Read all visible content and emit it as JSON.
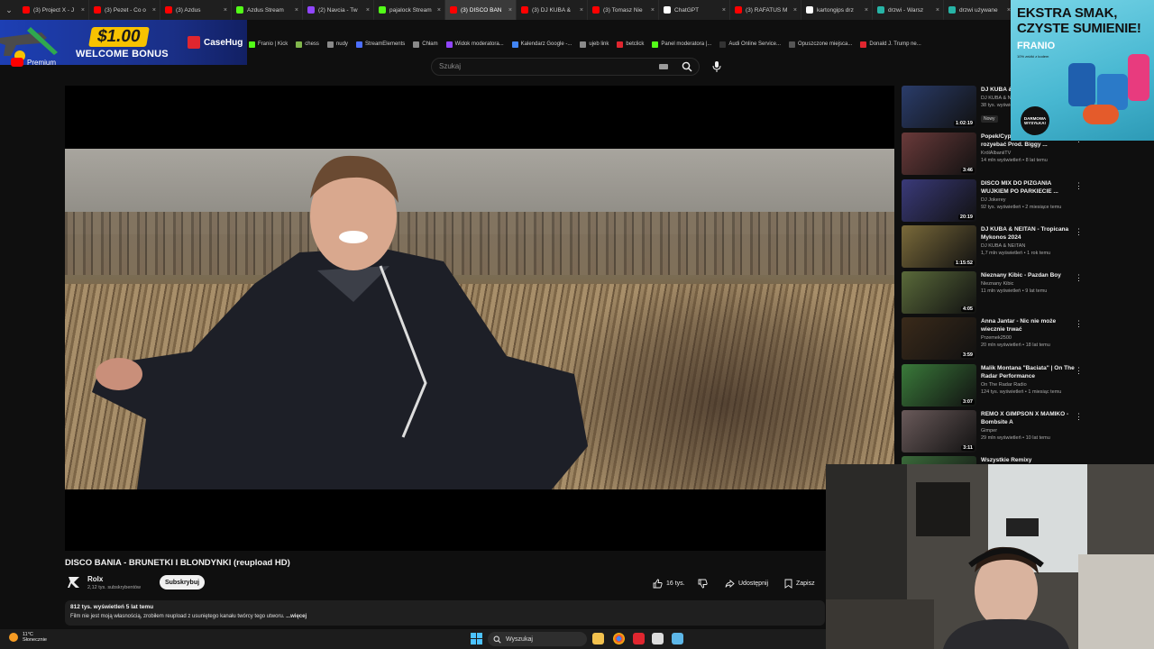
{
  "browser": {
    "tabs": [
      {
        "title": "(3) Project X - J",
        "active": false,
        "color": "#ff0000"
      },
      {
        "title": "(3) Pezet - Co o",
        "active": false,
        "color": "#ff0000"
      },
      {
        "title": "(3) Azdus",
        "active": false,
        "color": "#ff0000"
      },
      {
        "title": "Azdus Stream",
        "active": false,
        "color": "#53fc18"
      },
      {
        "title": "(2) Navcia - Tw",
        "active": false,
        "color": "#9146ff"
      },
      {
        "title": "pajalock Stream",
        "active": false,
        "color": "#53fc18"
      },
      {
        "title": "(3) DISCO BAN",
        "active": true,
        "color": "#ff0000"
      },
      {
        "title": "(3) DJ KUBA &",
        "active": false,
        "color": "#ff0000"
      },
      {
        "title": "(3) Tomasz Nie",
        "active": false,
        "color": "#ff0000"
      },
      {
        "title": "ChatGPT",
        "active": false,
        "color": "#ffffff"
      },
      {
        "title": "(3) RAFATUS M",
        "active": false,
        "color": "#ff0000"
      },
      {
        "title": "kartongips drz",
        "active": false,
        "color": "#ffffff"
      },
      {
        "title": "drzwi - Warsz",
        "active": false,
        "color": "#27b4a6"
      },
      {
        "title": "drzwi używane",
        "active": false,
        "color": "#27b4a6"
      },
      {
        "title": "drz",
        "active": false,
        "color": "#ffffff"
      }
    ],
    "bookmarks": [
      {
        "label": "Franio | Kick",
        "color": "#53fc18"
      },
      {
        "label": "chess",
        "color": "#81b64c"
      },
      {
        "label": "nudy",
        "color": "#8a8a8a"
      },
      {
        "label": "StreamElements",
        "color": "#4c6fff"
      },
      {
        "label": "Chłam",
        "color": "#8a8a8a"
      },
      {
        "label": "Widok moderatora...",
        "color": "#9146ff"
      },
      {
        "label": "Kalendarz Google -...",
        "color": "#4285f4"
      },
      {
        "label": "ujeb link",
        "color": "#8a8a8a"
      },
      {
        "label": "betclick",
        "color": "#e0262f"
      },
      {
        "label": "Panel moderatora |...",
        "color": "#53fc18"
      },
      {
        "label": "Audi Online Service...",
        "color": "#333333"
      },
      {
        "label": "Opuszczone miejsca...",
        "color": "#555555"
      },
      {
        "label": "Donald J. Trump ne...",
        "color": "#e0262f"
      }
    ]
  },
  "ad": {
    "amount": "$1.00",
    "bonus": "WELCOME BONUS",
    "brand": "CaseHug"
  },
  "premium_label": "Premium",
  "search": {
    "placeholder": "Szukaj"
  },
  "video": {
    "title": "DISCO BANIA - BRUNETKI I BLONDYNKI (reupload HD)",
    "channel": "Rolx",
    "subscribers": "2,12 tys. subskrybentów",
    "subscribe_label": "Subskrybuj",
    "likes": "16 tys.",
    "share_label": "Udostępnij",
    "save_label": "Zapisz",
    "views_age": "812 tys. wyświetleń  5 lat temu",
    "description": "Film nie jest moją własnością, zrobiłem reupload z usuniętego kanału twórcy tego utworu.",
    "more_label": "...więcej"
  },
  "recommendations": [
    {
      "title": "DJ KUBA & NEITAN - Rush 2026",
      "channel": "DJ KUBA & NEITAN",
      "stats": "38 tys. wyświetleń",
      "duration": "1:02:19",
      "badge": "Nowy",
      "thumb_color": "#2a3c6a"
    },
    {
      "title": "Popek/Cypis - Nie trzeba rozyebać  Prod. Biggy ...",
      "channel": "KrólAlbaniiTV",
      "stats": "14 mln wyświetleń • 8 lat temu",
      "duration": "3:46",
      "badge": "",
      "thumb_color": "#6a3a3a"
    },
    {
      "title": "DISCO MIX DO PIZGANIA WUJKIEM PO PARKIECIE ...",
      "channel": "DJ Jokerey",
      "stats": "92 tys. wyświetleń • 2 miesiące temu",
      "duration": "20:19",
      "badge": "",
      "thumb_color": "#3a3a7a"
    },
    {
      "title": "DJ KUBA & NEITAN - Tropicana Mykonos 2024",
      "channel": "DJ KUBA & NEITAN",
      "stats": "1,7 mln wyświetleń • 1 rok temu",
      "duration": "1:15:52",
      "badge": "",
      "thumb_color": "#7a6a3a"
    },
    {
      "title": "Nieznany Kibic - Pazdan Boy",
      "channel": "Nieznany Kibic",
      "stats": "11 mln wyświetleń • 9 lat temu",
      "duration": "4:05",
      "badge": "",
      "thumb_color": "#5a6a3a"
    },
    {
      "title": "Anna Jantar - Nic nie może wiecznie trwać",
      "channel": "Przemek2500",
      "stats": "20 mln wyświetleń • 18 lat temu",
      "duration": "3:59",
      "badge": "",
      "thumb_color": "#3a2a1a"
    },
    {
      "title": "Malik Montana \"Baciata\" | On The Radar Performance",
      "channel": "On The Radar Radio",
      "stats": "124 tys. wyświetleń • 1 miesiąc temu",
      "duration": "3:07",
      "badge": "",
      "thumb_color": "#3a7a3a"
    },
    {
      "title": "REMO X GIMPSON X MAMIKO - Bombsite A",
      "channel": "Gimper",
      "stats": "29 mln wyświetleń • 10 lat temu",
      "duration": "3:11",
      "badge": "",
      "thumb_color": "#6a5a5a"
    },
    {
      "title": "Wszystkie Remixy",
      "channel": "",
      "stats": "",
      "duration": "",
      "badge": "",
      "thumb_color": "#3a6a3a"
    }
  ],
  "franio_ad": {
    "line1": "EKSTRA SMAK,",
    "line2": "CZYSTE SUMIENIE!",
    "brand": "FRANIO",
    "small": "10% zniżki z kodem",
    "badge": "DARMOWA WYSYŁKA!"
  },
  "taskbar": {
    "temp": "11°C",
    "weather": "Słonecznie",
    "search_label": "Wyszukaj"
  }
}
